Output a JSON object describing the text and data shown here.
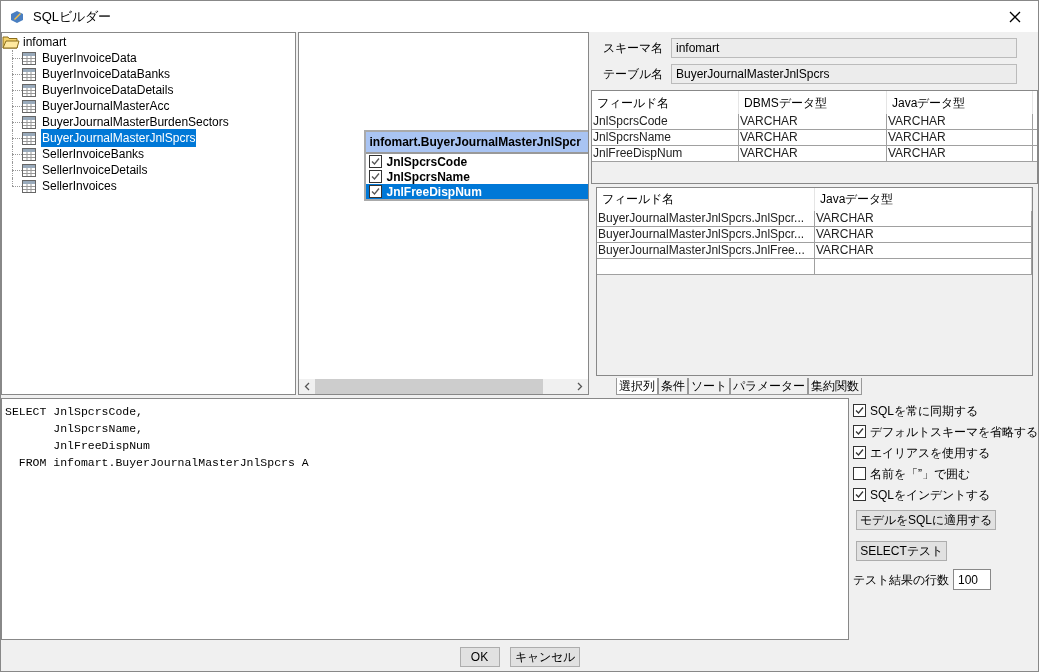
{
  "window": {
    "title": "SQLビルダー"
  },
  "tree": {
    "label": "infomart",
    "children": [
      {
        "label": "BuyerInvoiceData",
        "selected": false
      },
      {
        "label": "BuyerInvoiceDataBanks",
        "selected": false
      },
      {
        "label": "BuyerInvoiceDataDetails",
        "selected": false
      },
      {
        "label": "BuyerJournalMasterAcc",
        "selected": false
      },
      {
        "label": "BuyerJournalMasterBurdenSectors",
        "selected": false
      },
      {
        "label": "BuyerJournalMasterJnlSpcrs",
        "selected": true
      },
      {
        "label": "SellerInvoiceBanks",
        "selected": false
      },
      {
        "label": "SellerInvoiceDetails",
        "selected": false
      },
      {
        "label": "SellerInvoices",
        "selected": false
      }
    ]
  },
  "canvas_table": {
    "title": "infomart.BuyerJournalMasterJnlSpcr",
    "fields": [
      {
        "label": "JnlSpcrsCode",
        "checked": true,
        "selected": false
      },
      {
        "label": "JnlSpcrsName",
        "checked": true,
        "selected": false
      },
      {
        "label": "JnlFreeDispNum",
        "checked": true,
        "selected": true
      }
    ]
  },
  "schema": {
    "label": "スキーマ名",
    "value": "infomart"
  },
  "table_name": {
    "label": "テーブル名",
    "value": "BuyerJournalMasterJnlSpcrs"
  },
  "fields_table": {
    "columns": [
      "フィールド名",
      "DBMSデータ型",
      "Javaデータ型"
    ],
    "rows": [
      [
        "JnlSpcrsCode",
        "VARCHAR",
        "VARCHAR"
      ],
      [
        "JnlSpcrsName",
        "VARCHAR",
        "VARCHAR"
      ],
      [
        "JnlFreeDispNum",
        "VARCHAR",
        "VARCHAR"
      ]
    ]
  },
  "selected_columns_table": {
    "columns": [
      "フィールド名",
      "Javaデータ型"
    ],
    "rows": [
      [
        "BuyerJournalMasterJnlSpcrs.JnlSpcr...",
        "VARCHAR"
      ],
      [
        "BuyerJournalMasterJnlSpcrs.JnlSpcr...",
        "VARCHAR"
      ],
      [
        "BuyerJournalMasterJnlSpcrs.JnlFree...",
        "VARCHAR"
      ]
    ]
  },
  "tabs": [
    {
      "label": "選択列",
      "selected": true
    },
    {
      "label": "条件",
      "selected": false
    },
    {
      "label": "ソート",
      "selected": false
    },
    {
      "label": "パラメーター",
      "selected": false
    },
    {
      "label": "集約関数",
      "selected": false
    }
  ],
  "sql_lines": [
    "SELECT JnlSpcrsCode,",
    "       JnlSpcrsName,",
    "       JnlFreeDispNum",
    "  FROM infomart.BuyerJournalMasterJnlSpcrs A"
  ],
  "options": [
    {
      "label": "SQLを常に同期する",
      "checked": true
    },
    {
      "label": "デフォルトスキーマを省略する",
      "checked": true
    },
    {
      "label": "エイリアスを使用する",
      "checked": true
    },
    {
      "label": "名前を「”」で囲む",
      "checked": false
    },
    {
      "label": "SQLをインデントする",
      "checked": true
    }
  ],
  "apply_button": "モデルをSQLに適用する",
  "test_button": "SELECTテスト",
  "rows_field": {
    "label": "テスト結果の行数",
    "value": "100"
  },
  "buttons": [
    "OK",
    "キャンセル"
  ]
}
